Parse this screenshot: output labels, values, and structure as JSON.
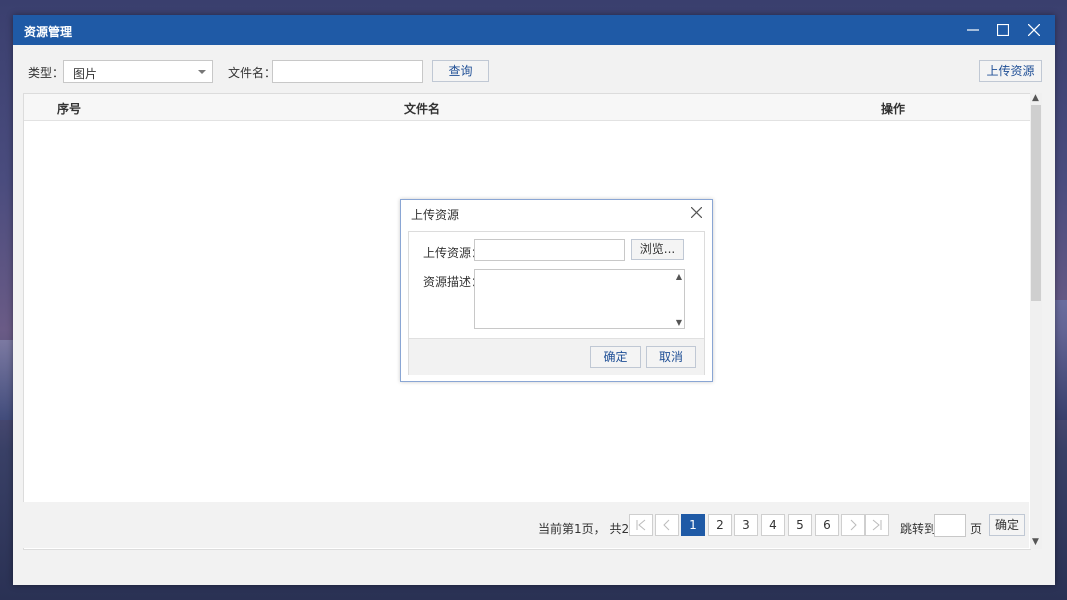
{
  "window": {
    "title": "资源管理"
  },
  "toolbar": {
    "type_label": "类型：",
    "type_value": "图片",
    "filename_label": "文件名：",
    "filename_value": "",
    "query_button": "查询",
    "upload_button": "上传资源"
  },
  "table": {
    "columns": [
      "序号",
      "文件名",
      "操作"
    ],
    "rows": []
  },
  "pager": {
    "info": "当前第1页， 共2页",
    "pages": [
      "1",
      "2",
      "3",
      "4",
      "5",
      "6"
    ],
    "current_page": "1",
    "jump_label": "跳转到",
    "jump_value": "",
    "page_unit": "页",
    "confirm_button": "确定"
  },
  "dialog": {
    "title": "上传资源",
    "upload_label": "上传资源：",
    "upload_value": "",
    "browse_button": "浏览...",
    "desc_label": "资源描述：",
    "desc_value": "",
    "ok_button": "确定",
    "cancel_button": "取消"
  }
}
